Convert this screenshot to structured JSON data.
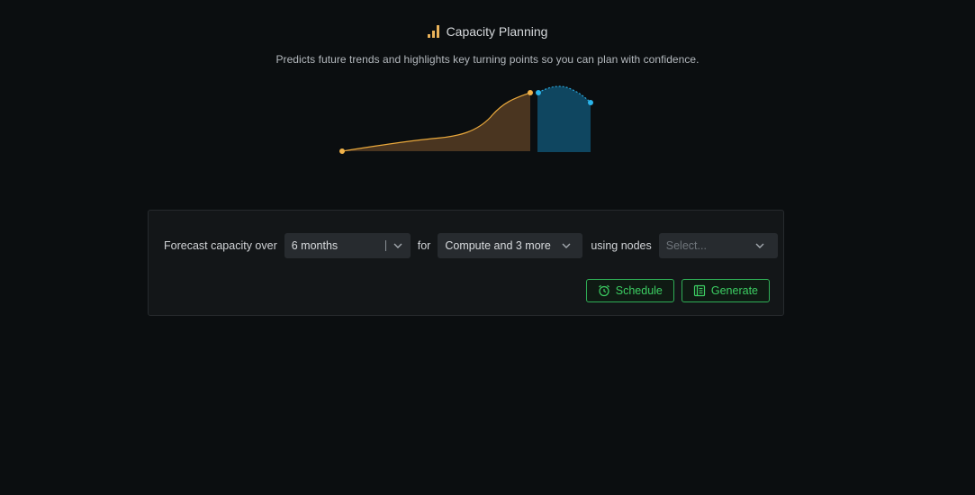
{
  "header": {
    "title": "Capacity Planning",
    "title_icon": "bar-chart-icon",
    "subtitle": "Predicts future trends and highlights key turning points so you can plan with confidence."
  },
  "form": {
    "label_over": "Forecast capacity over",
    "period": {
      "value": "6 months"
    },
    "label_for": "for",
    "resources": {
      "value": "Compute and 3 more"
    },
    "label_nodes": "using nodes",
    "nodes": {
      "placeholder": "Select..."
    }
  },
  "actions": {
    "schedule_label": "Schedule",
    "schedule_icon": "alarm-clock-icon",
    "generate_label": "Generate",
    "generate_icon": "report-icon"
  },
  "colors": {
    "accent_green": "#3ccf63",
    "history_line": "#e9a83c",
    "forecast_line": "#2aa7dc",
    "background": "#0b0e10"
  }
}
